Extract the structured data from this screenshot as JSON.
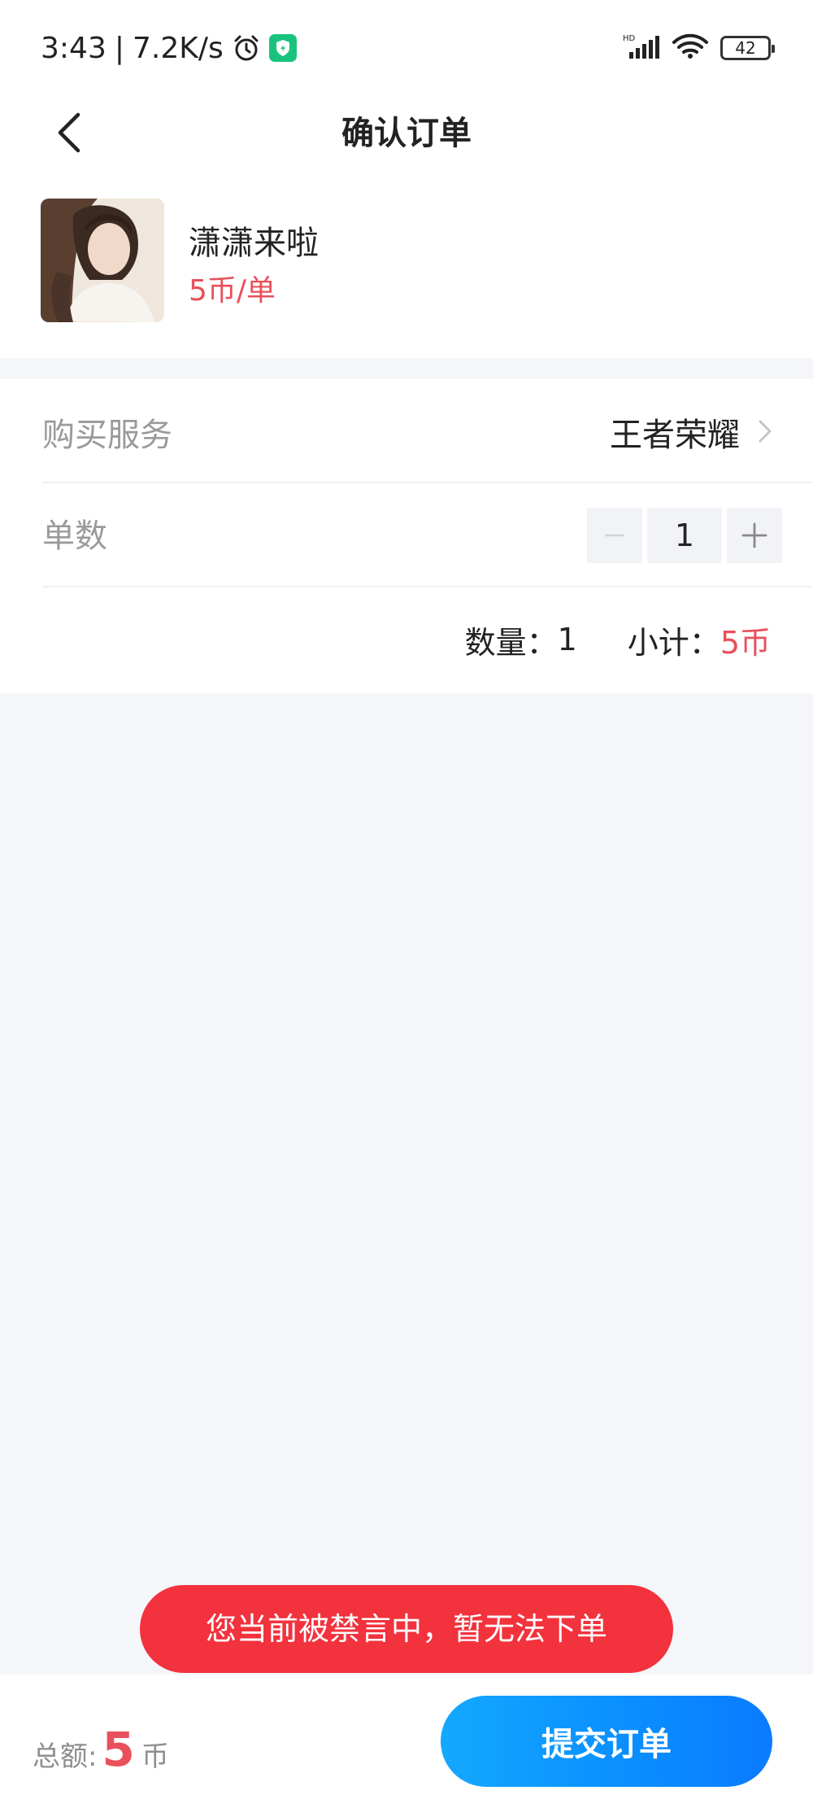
{
  "status_bar": {
    "time": "3:43",
    "separator": "|",
    "net_speed": "7.2K/s",
    "battery": "42"
  },
  "header": {
    "title": "确认订单"
  },
  "profile": {
    "name": "潇潇来啦",
    "price": "5币/单"
  },
  "order": {
    "service_label": "购买服务",
    "service_value": "王者荣耀",
    "count_label": "单数",
    "count_value": "1",
    "quantity_label": "数量：",
    "quantity_value": "1",
    "subtotal_label": "小计：",
    "subtotal_value": "5币"
  },
  "toast": {
    "message": "您当前被禁言中，暂无法下单"
  },
  "footer": {
    "total_label": "总额:",
    "total_amount": "5",
    "total_unit": "币",
    "submit_label": "提交订单"
  },
  "colors": {
    "accent_red": "#e8505b",
    "toast_red": "#f2323d",
    "submit_blue": "#0a8dff"
  },
  "icons": [
    "alarm-icon",
    "shield-app-icon",
    "signal-icon",
    "wifi-icon",
    "battery-icon",
    "back-arrow-icon",
    "chevron-right-icon",
    "minus-icon",
    "plus-icon"
  ]
}
